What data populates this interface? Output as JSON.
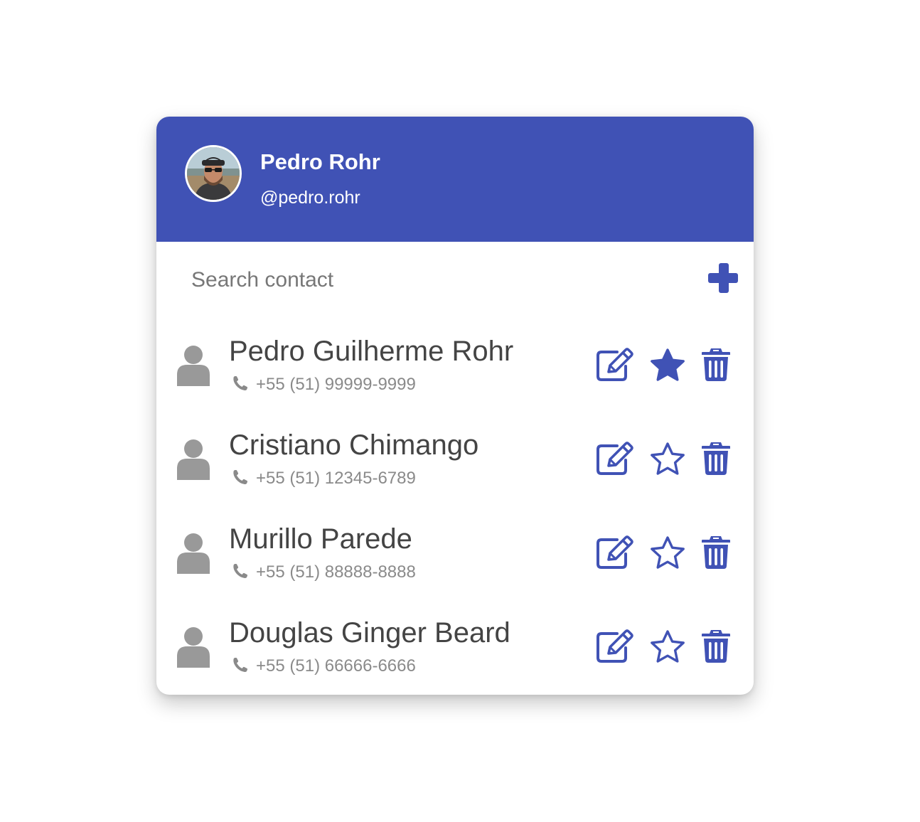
{
  "colors": {
    "accent": "#4052b5",
    "contact_name": "#444444",
    "phone_text": "#8a8a8a",
    "placeholder": "#777777",
    "person_icon": "#999999"
  },
  "profile": {
    "name": "Pedro Rohr",
    "handle": "@pedro.rohr"
  },
  "search": {
    "placeholder": "Search contact",
    "value": ""
  },
  "toolbar": {
    "add_icon": "plus-icon"
  },
  "contacts": [
    {
      "name": "Pedro Guilherme Rohr",
      "phone": "+55 (51) 99999-9999",
      "favorite": true
    },
    {
      "name": "Cristiano Chimango",
      "phone": "+55 (51) 12345-6789",
      "favorite": false
    },
    {
      "name": "Murillo Parede",
      "phone": "+55 (51) 88888-8888",
      "favorite": false
    },
    {
      "name": "Douglas Ginger Beard",
      "phone": "+55 (51) 66666-6666",
      "favorite": false
    }
  ],
  "row_icons": {
    "person": "person-icon",
    "phone": "phone-icon",
    "edit": "edit-icon",
    "favorite": "star-icon",
    "delete": "trash-icon"
  }
}
